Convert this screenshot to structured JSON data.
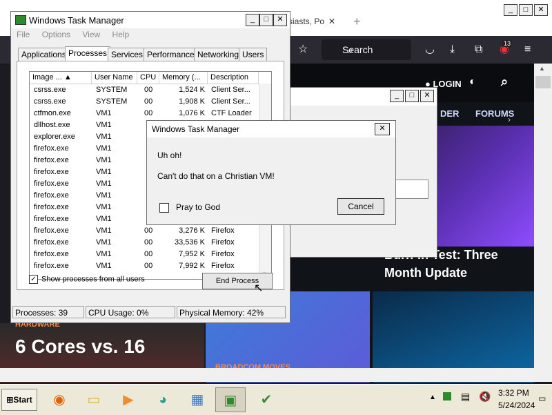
{
  "browser": {
    "tab_title": "siasts, Po",
    "tab_close": "✕",
    "new_tab": "+",
    "search_placeholder": "Search",
    "badge_count": "13",
    "site": {
      "login": "LOGIN",
      "nav_rider": "DER",
      "nav_forums": "FORUMS",
      "hero_title": "Burn-In Test: Three Month Update",
      "card_left_kicker": "HARDWARE",
      "card_left_title": "6 Cores vs. 16",
      "card_mid_kicker": "BROADCOM MOVES"
    }
  },
  "taskmgr": {
    "title": "Windows Task Manager",
    "menu": [
      "File",
      "Options",
      "View",
      "Help"
    ],
    "tabs": [
      "Applications",
      "Processes",
      "Services",
      "Performance",
      "Networking",
      "Users"
    ],
    "active_tab": "Processes",
    "columns": [
      "Image ...",
      "User Name",
      "CPU",
      "Memory (...",
      "Description"
    ],
    "rows": [
      {
        "image": "csrss.exe",
        "user": "SYSTEM",
        "cpu": "00",
        "mem": "1,524 K",
        "desc": "Client Ser..."
      },
      {
        "image": "csrss.exe",
        "user": "SYSTEM",
        "cpu": "00",
        "mem": "1,908 K",
        "desc": "Client Ser..."
      },
      {
        "image": "ctfmon.exe",
        "user": "VM1",
        "cpu": "00",
        "mem": "1,076 K",
        "desc": "CTF Loader"
      },
      {
        "image": "dllhost.exe",
        "user": "VM1",
        "cpu": "",
        "mem": "",
        "desc": ""
      },
      {
        "image": "explorer.exe",
        "user": "VM1",
        "cpu": "",
        "mem": "",
        "desc": ""
      },
      {
        "image": "firefox.exe",
        "user": "VM1",
        "cpu": "",
        "mem": "",
        "desc": ""
      },
      {
        "image": "firefox.exe",
        "user": "VM1",
        "cpu": "",
        "mem": "",
        "desc": ""
      },
      {
        "image": "firefox.exe",
        "user": "VM1",
        "cpu": "",
        "mem": "",
        "desc": ""
      },
      {
        "image": "firefox.exe",
        "user": "VM1",
        "cpu": "",
        "mem": "",
        "desc": ""
      },
      {
        "image": "firefox.exe",
        "user": "VM1",
        "cpu": "",
        "mem": "",
        "desc": ""
      },
      {
        "image": "firefox.exe",
        "user": "VM1",
        "cpu": "",
        "mem": "",
        "desc": ""
      },
      {
        "image": "firefox.exe",
        "user": "VM1",
        "cpu": "",
        "mem": "",
        "desc": ""
      },
      {
        "image": "firefox.exe",
        "user": "VM1",
        "cpu": "00",
        "mem": "3,276 K",
        "desc": "Firefox"
      },
      {
        "image": "firefox.exe",
        "user": "VM1",
        "cpu": "00",
        "mem": "33,536 K",
        "desc": "Firefox"
      },
      {
        "image": "firefox.exe",
        "user": "VM1",
        "cpu": "00",
        "mem": "7,952 K",
        "desc": "Firefox"
      },
      {
        "image": "firefox.exe",
        "user": "VM1",
        "cpu": "00",
        "mem": "7,992 K",
        "desc": "Firefox"
      }
    ],
    "show_all_label": "Show processes from all users",
    "end_process": "End Process",
    "status": {
      "processes": "Processes: 39",
      "cpu": "CPU Usage: 0%",
      "memory": "Physical Memory: 42%"
    }
  },
  "dialog": {
    "title": "Windows Task Manager",
    "close": "✕",
    "message1": "Uh oh!",
    "message2": "Can't do that on a Christian VM!",
    "checkbox_label": "Pray to God",
    "cancel": "Cancel"
  },
  "taskbar": {
    "start": "Start",
    "time": "3:32 PM",
    "date": "5/24/2024"
  }
}
